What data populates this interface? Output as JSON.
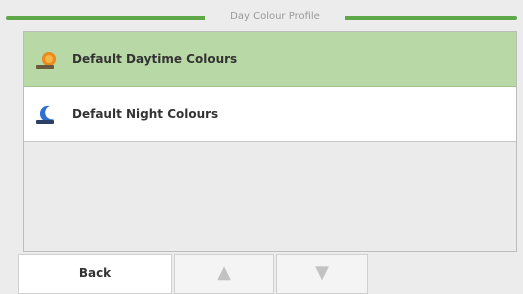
{
  "header": {
    "title": "Day Colour Profile"
  },
  "profiles": [
    {
      "label": "Default Daytime Colours",
      "icon": "sun-icon",
      "selected": true
    },
    {
      "label": "Default Night Colours",
      "icon": "moon-icon",
      "selected": false
    }
  ],
  "footer": {
    "back_label": "Back",
    "up_icon": "arrow-up-icon",
    "down_icon": "arrow-down-icon"
  },
  "colors": {
    "accent": "#5ea84a",
    "selected_row": "#b8d8a6"
  }
}
